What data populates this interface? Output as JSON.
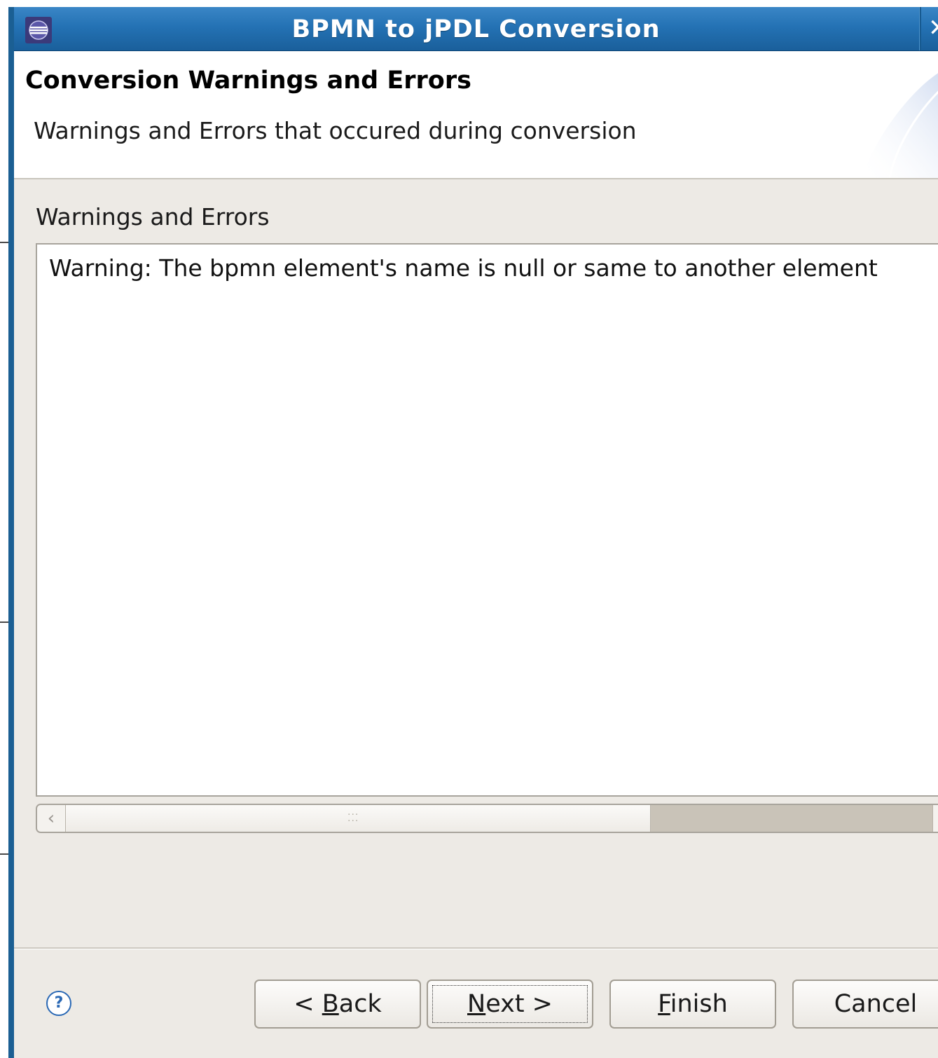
{
  "window": {
    "title": "BPMN to jPDL Conversion",
    "close_glyph": "✕",
    "titlebar_color": "#2472b4"
  },
  "header": {
    "title": "Conversion Warnings and Errors",
    "description": "Warnings and Errors that occured during conversion"
  },
  "messages": {
    "label": "Warnings and Errors",
    "lines": [
      "Warning: The bpmn element's name is null or same to another element"
    ]
  },
  "buttons": {
    "back": {
      "prefix": "< ",
      "mnemonic": "B",
      "rest": "ack"
    },
    "next": {
      "prefix": "",
      "mnemonic": "N",
      "rest": "ext >"
    },
    "finish": {
      "prefix": "",
      "mnemonic": "F",
      "rest": "inish"
    },
    "cancel": {
      "label": "Cancel"
    },
    "help_glyph": "?"
  },
  "icons": {
    "app": "eclipse-icon",
    "help": "help-icon",
    "close": "close-icon",
    "scroll_left": "chevron-left-icon",
    "scroll_right": "chevron-right-icon"
  },
  "scrollbar": {
    "thumb_position_fraction": 0.0,
    "thumb_size_fraction": 0.66
  }
}
